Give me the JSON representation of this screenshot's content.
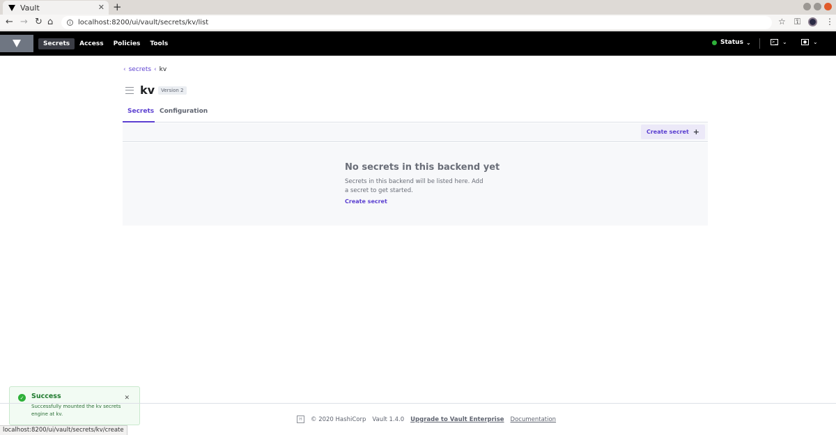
{
  "browser": {
    "tab_title": "Vault",
    "url": "localhost:8200/ui/vault/secrets/kv/list",
    "status_url": "localhost:8200/ui/vault/secrets/kv/create"
  },
  "nav": {
    "items": [
      "Secrets",
      "Access",
      "Policies",
      "Tools"
    ],
    "status_label": "Status",
    "status_color": "#2eb039"
  },
  "breadcrumb": {
    "link": "secrets",
    "current": "kv"
  },
  "page": {
    "title": "kv",
    "version_badge": "Version 2",
    "tabs": [
      "Secrets",
      "Configuration"
    ],
    "active_tab": "Secrets",
    "create_button": "Create secret",
    "accent": "#5a3ed0"
  },
  "empty_state": {
    "title": "No secrets in this backend yet",
    "message": "Secrets in this backend will be listed here. Add a secret to get started.",
    "link": "Create secret"
  },
  "toast": {
    "title": "Success",
    "message": "Successfully mounted the kv secrets engine at kv."
  },
  "footer": {
    "copyright": "© 2020 HashiCorp",
    "version": "Vault 1.4.0",
    "upgrade_link": "Upgrade to Vault Enterprise",
    "docs_link": "Documentation"
  }
}
